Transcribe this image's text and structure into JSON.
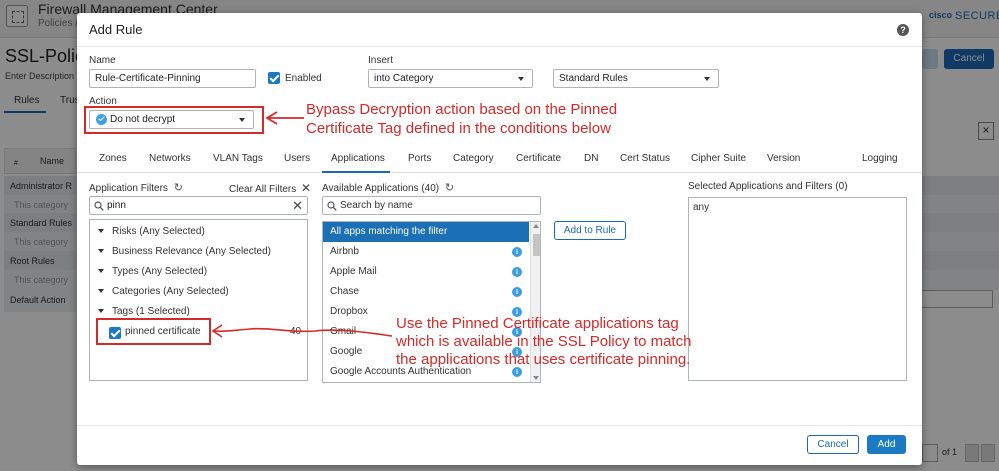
{
  "background": {
    "app_title": "Firewall Management Center",
    "app_subtitle": "Policies /",
    "cisco_logo": "cisco",
    "cisco_secure": "SECURE",
    "policy_title": "SSL-Polic",
    "enter_description": "Enter Description",
    "tab_rules": "Rules",
    "tab_trusted": "Trus",
    "cancel_button": "Cancel",
    "col_hash": "#",
    "col_name": "Name",
    "rows": [
      {
        "label": "Administrator R",
        "kind": "section"
      },
      {
        "label": "This category",
        "kind": "empty"
      },
      {
        "label": "Standard Rules",
        "kind": "section"
      },
      {
        "label": "This category",
        "kind": "empty"
      },
      {
        "label": "Root Rules",
        "kind": "section"
      },
      {
        "label": "This category",
        "kind": "empty"
      },
      {
        "label": "Default Action",
        "kind": "section"
      }
    ],
    "pager_of": "of 1"
  },
  "modal": {
    "title": "Add Rule",
    "help_icon": "?",
    "name_label": "Name",
    "name_value": "Rule-Certificate-Pinning",
    "enabled_label": "Enabled",
    "insert_label": "Insert",
    "insert_value": "into Category",
    "category_value": "Standard Rules",
    "action_label": "Action",
    "action_value": "Do not decrypt",
    "tabs": [
      "Zones",
      "Networks",
      "VLAN Tags",
      "Users",
      "Applications",
      "Ports",
      "Category",
      "Certificate",
      "DN",
      "Cert Status",
      "Cipher Suite",
      "Version",
      "Logging"
    ],
    "active_tab": "Applications",
    "app_filters_label": "Application Filters",
    "clear_all_filters": "Clear All Filters",
    "filter_search_value": "pinn",
    "filters": [
      "Risks (Any Selected)",
      "Business Relevance (Any Selected)",
      "Types (Any Selected)",
      "Categories (Any Selected)",
      "Tags (1 Selected)"
    ],
    "tag_item_label": "pinned certificate",
    "tag_item_count": "40",
    "available_apps_label": "Available Applications (40)",
    "available_search_placeholder": "Search by name",
    "apps": [
      "All apps matching the filter",
      "Airbnb",
      "Apple Mail",
      "Chase",
      "Dropbox",
      "Gmail",
      "Google",
      "Google Accounts Authentication"
    ],
    "add_to_rule_button": "Add to Rule",
    "selected_label": "Selected Applications and Filters (0)",
    "selected_value": "any",
    "cancel_button": "Cancel",
    "add_button": "Add"
  },
  "annotations": {
    "action_note_line1": "Bypass Decryption action based on the Pinned",
    "action_note_line2": "Certificate Tag defined in the conditions below",
    "tag_note_line1": "Use the Pinned Certificate applications tag",
    "tag_note_line2": "which is available in the SSL Policy to match",
    "tag_note_line3": "the applications that uses certificate pinning.",
    "color": "#d52a2a"
  },
  "colors": {
    "accent": "#1b6ab8",
    "selected_row": "#1a6fb5",
    "info": "#3b9ee0"
  }
}
